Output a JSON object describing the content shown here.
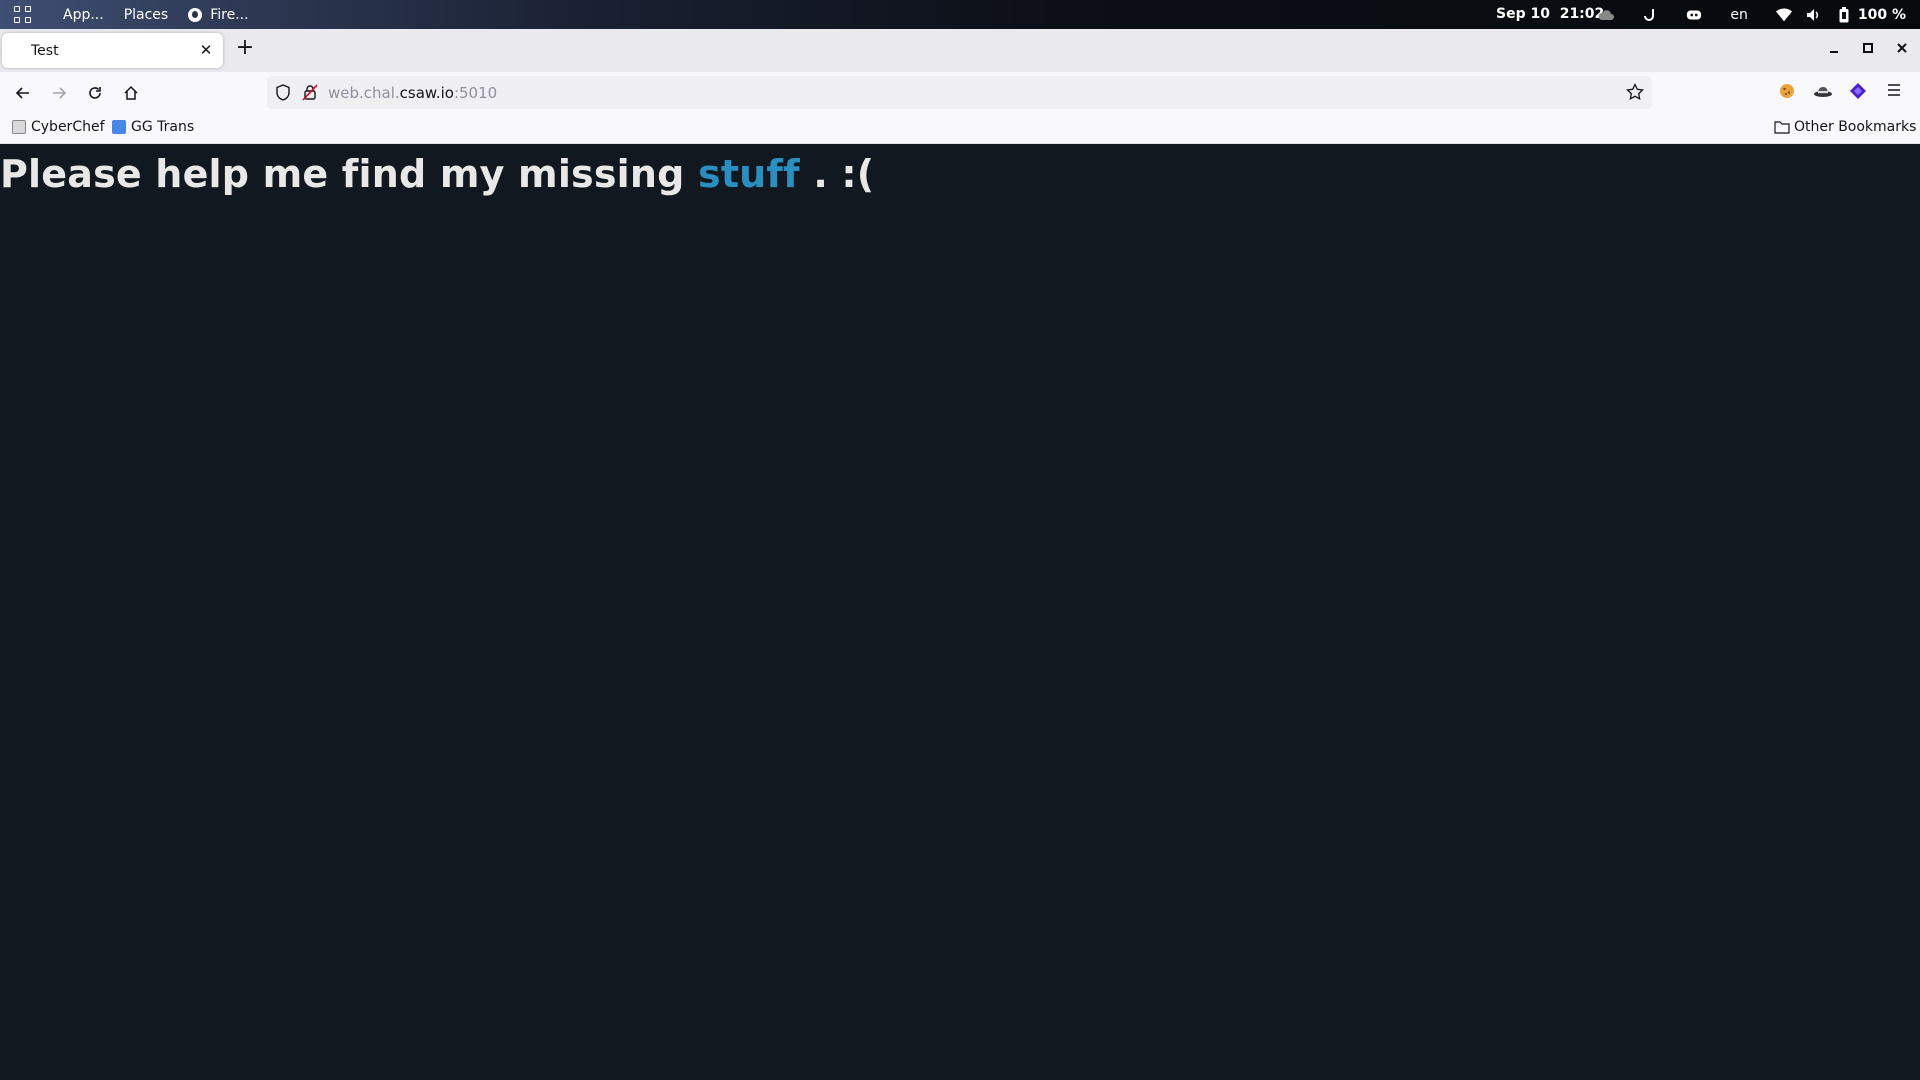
{
  "system_bar": {
    "apps_label": "App...",
    "places_label": "Places",
    "firefox_label": "Fire...",
    "datetime": "Sep 10  21:02",
    "language": "en",
    "battery": "100 %"
  },
  "browser": {
    "tab_title": "Test",
    "url_prefix": "web.chal.",
    "url_host": "csaw.io",
    "url_suffix": ":5010",
    "bookmarks": [
      "CyberChef",
      "GG Trans"
    ],
    "other_bookmarks": "Other Bookmarks"
  },
  "page": {
    "heading_start": "Please help me find my missing ",
    "heading_link": "stuff",
    "heading_end": " . :("
  },
  "colors": {
    "page_background": "#111820",
    "link": "#2a8fc0",
    "heading_text": "#e8e8e8"
  }
}
